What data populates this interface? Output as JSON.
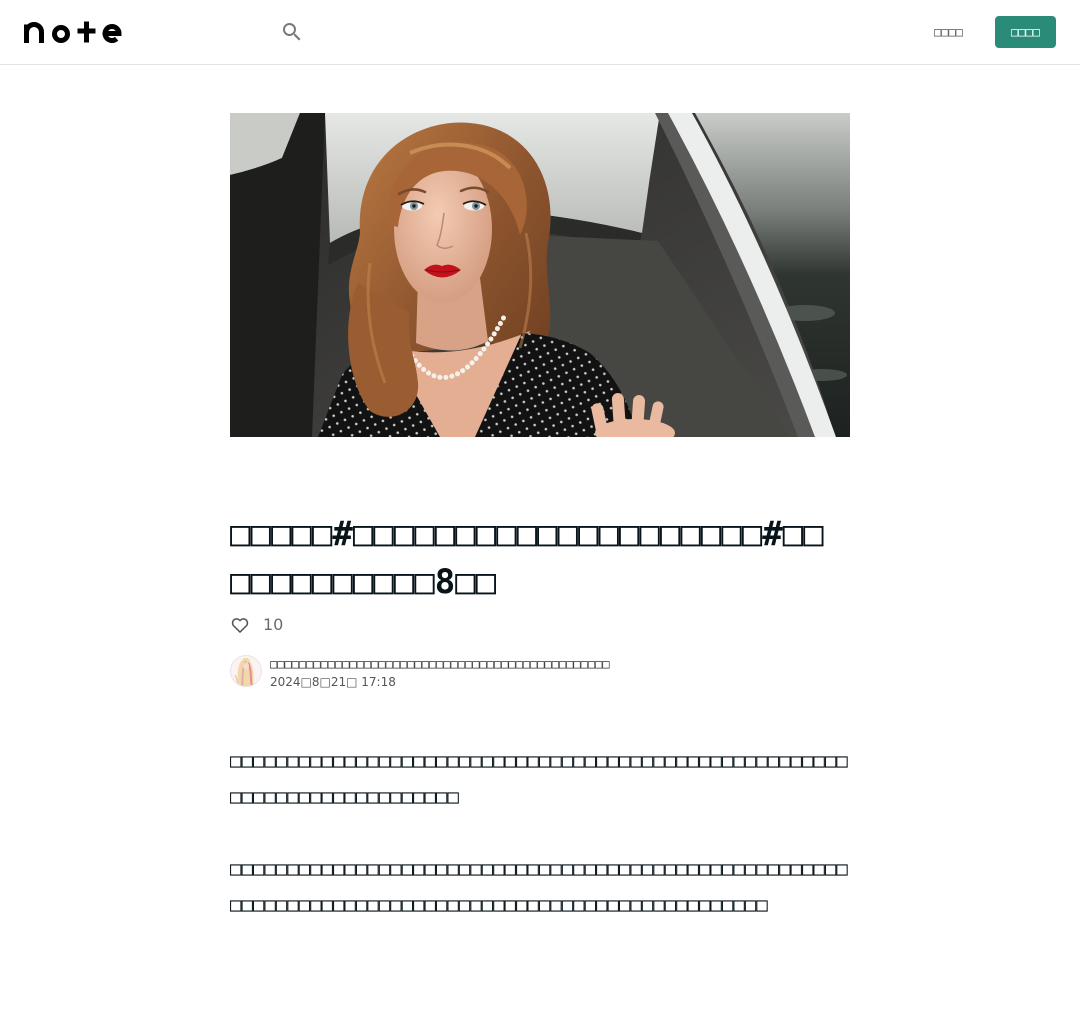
{
  "header": {
    "logo_text": "note",
    "logo_icon": "note-logo",
    "search_icon": "search-icon",
    "login_label": "□□□□",
    "signup_label": "□□□□",
    "accent_color": "#2a8c78"
  },
  "article": {
    "title": "□□□□□#□□□□□□□□□□□□□□□□□□□□#□□□□□□□□□□□□8□□",
    "like_icon": "heart-icon",
    "like_count": "10",
    "author": {
      "avatar_icon": "avatar",
      "name": "□□□□□□□□□□□□□□□□□□□□□□□□□□□□□□□□□□□□□□□□□□□□□□□",
      "date": "2024□8□21□ 17:18"
    },
    "paragraphs": [
      "□□□□□□□□□□□□□□□□□□□□□□□□□□□□□□□□□□□□□□□□□□□□□□□□□□□□□□□□□□□□□□□□□□□□□□□□□□",
      "□□□□□□□□□□□□□□□□□□□□□□□□□□□□□□□□□□□□□□□□□□□□□□□□□□□□□□□□□□□□□□□□□□□□□□□□□□□□□□□□□□□□□□□□□□□□□□□□□□□□□"
    ]
  }
}
